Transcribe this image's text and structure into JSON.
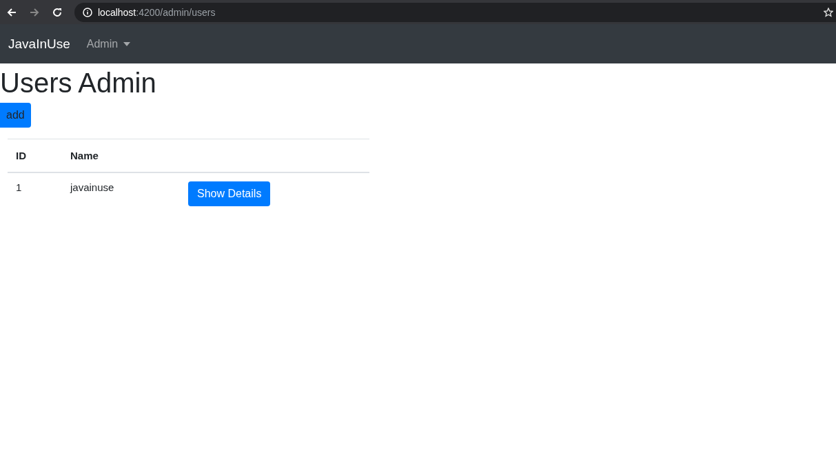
{
  "browser": {
    "url_host": "localhost",
    "url_path": ":4200/admin/users"
  },
  "navbar": {
    "brand": "JavaInUse",
    "menu": {
      "label": "Admin",
      "expanded": false
    }
  },
  "page": {
    "title": "Users Admin",
    "add_button": "add"
  },
  "table": {
    "columns": [
      "ID",
      "Name"
    ],
    "rows": [
      {
        "id": "1",
        "name": "javainuse",
        "action": "Show Details"
      }
    ]
  }
}
